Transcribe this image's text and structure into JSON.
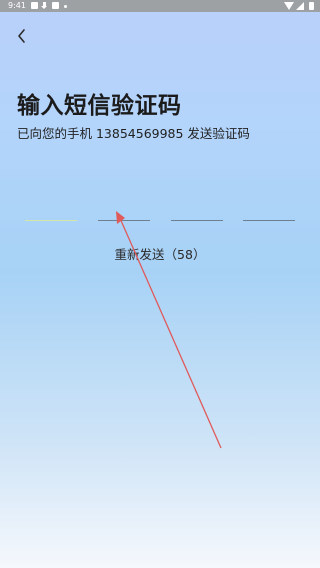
{
  "status_bar": {
    "time": "9:41",
    "icons": [
      "image-notification-icon",
      "download-icon",
      "app-notification-icon",
      "dot-icon",
      "wifi-icon",
      "signal-icon",
      "battery-icon"
    ]
  },
  "nav": {
    "back_icon": "chevron-left-icon"
  },
  "header": {
    "title": "输入短信验证码",
    "subtitle": "已向您的手机 13854569985 发送验证码"
  },
  "code_input": {
    "slots": [
      "",
      "",
      "",
      ""
    ],
    "active_slot": 1,
    "active_color": "#d6e6a4",
    "inactive_color": "#6f7f92"
  },
  "resend": {
    "label": "重新发送（58）"
  },
  "annotation": {
    "type": "arrow",
    "color": "#e05a5a"
  }
}
